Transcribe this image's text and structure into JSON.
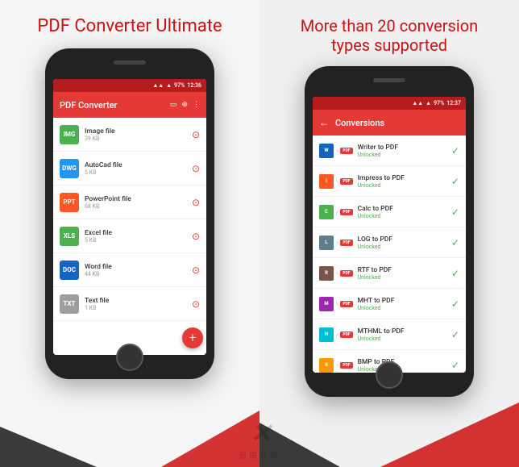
{
  "left": {
    "title": "PDF Converter Ultimate",
    "toolbar": {
      "title": "PDF Converter"
    },
    "status_bar": {
      "signal": "▲▲▲",
      "battery": "97%",
      "time": "12:36"
    },
    "files": [
      {
        "name": "Image file",
        "size": "39 KB",
        "icon_type": "img",
        "icon_label": "IMG"
      },
      {
        "name": "AutoCad file",
        "size": "5 KB",
        "icon_type": "cad",
        "icon_label": "DWG"
      },
      {
        "name": "PowerPoint file",
        "size": "68 KB",
        "icon_type": "ppt",
        "icon_label": "PPT"
      },
      {
        "name": "Excel file",
        "size": "5 KB",
        "icon_type": "xls",
        "icon_label": "XLS"
      },
      {
        "name": "Word file",
        "size": "44 KB",
        "icon_type": "doc",
        "icon_label": "DOC"
      },
      {
        "name": "Text file",
        "size": "1 KB",
        "icon_type": "txt",
        "icon_label": "TXT"
      }
    ],
    "fab_label": "+"
  },
  "right": {
    "title": "More than 20 conversion\ntypes supported",
    "toolbar": {
      "back": "←",
      "title": "Conversions"
    },
    "status_bar": {
      "signal": "▲▲▲",
      "battery": "97%",
      "time": "12:37"
    },
    "conversions": [
      {
        "from": "W",
        "from_type": "ci-writer",
        "name": "Writer to PDF",
        "status": "Unlocked"
      },
      {
        "from": "I",
        "from_type": "ci-impress",
        "name": "Impress to PDF",
        "status": "Unlocked"
      },
      {
        "from": "C",
        "from_type": "ci-calc",
        "name": "Calc to PDF",
        "status": "Unlocked"
      },
      {
        "from": "L",
        "from_type": "ci-log",
        "name": "LOG to PDF",
        "status": "Unlocked"
      },
      {
        "from": "R",
        "from_type": "ci-rtf",
        "name": "RTF to PDF",
        "status": "Unlocked"
      },
      {
        "from": "M",
        "from_type": "ci-mht",
        "name": "MHT to PDF",
        "status": "Unlocked"
      },
      {
        "from": "H",
        "from_type": "ci-mthml",
        "name": "MTHML to PDF",
        "status": "Unlocked"
      },
      {
        "from": "B",
        "from_type": "ci-bmp",
        "name": "BMP to PDF",
        "status": "Unlocked"
      }
    ],
    "pdf_label": "PDF",
    "unlocked_label": "Unlocked"
  },
  "watermark": {
    "symbol": "✕",
    "text": "自由互联"
  }
}
